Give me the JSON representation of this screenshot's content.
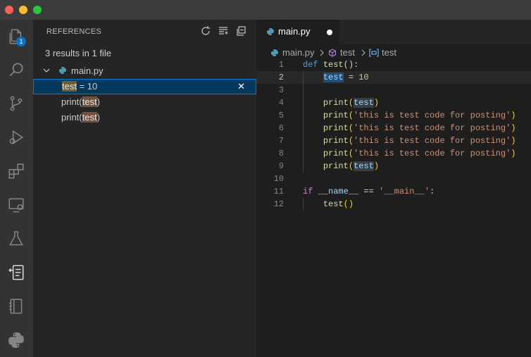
{
  "window": {
    "traffic_colors": [
      "#ff5f57",
      "#febc2e",
      "#28c840"
    ]
  },
  "activity": {
    "items": [
      "explorer-icon",
      "search-icon",
      "source-control-icon",
      "run-debug-icon",
      "extensions-icon",
      "remote-explorer-icon",
      "testing-icon",
      "references-icon",
      "notebook-icon",
      "python-icon"
    ],
    "explorer_badge": "1"
  },
  "sidebar": {
    "title": "REFERENCES",
    "summary": "3 results in 1 file",
    "file": "main.py",
    "results": [
      {
        "before": "",
        "match": "test",
        "after": " = 10"
      },
      {
        "before": "print(",
        "match": "test",
        "after": ")"
      },
      {
        "before": "print(",
        "match": "test",
        "after": ")"
      }
    ],
    "dismiss_glyph": "✕"
  },
  "editor": {
    "tab_label": "main.py",
    "breadcrumb": [
      "main.py",
      "test",
      "test"
    ],
    "code": {
      "line_numbers": [
        "1",
        "2",
        "3",
        "4",
        "5",
        "6",
        "7",
        "8",
        "9",
        "10",
        "11",
        "12"
      ],
      "def_kw": "def",
      "fn_name": "test",
      "parens_colon": "():",
      "var": "test",
      "assign": " = ",
      "num": "10",
      "print": "print",
      "str": "'this is test code for posting'",
      "if_kw": "if",
      "dunder_name": "__name__",
      "eq": " == ",
      "main_str": "'__main__'",
      "colon": ":",
      "call": "()"
    }
  },
  "colors": {
    "accent": "#007fd4",
    "selection": "#04395e",
    "badge": "#0e70c0"
  }
}
